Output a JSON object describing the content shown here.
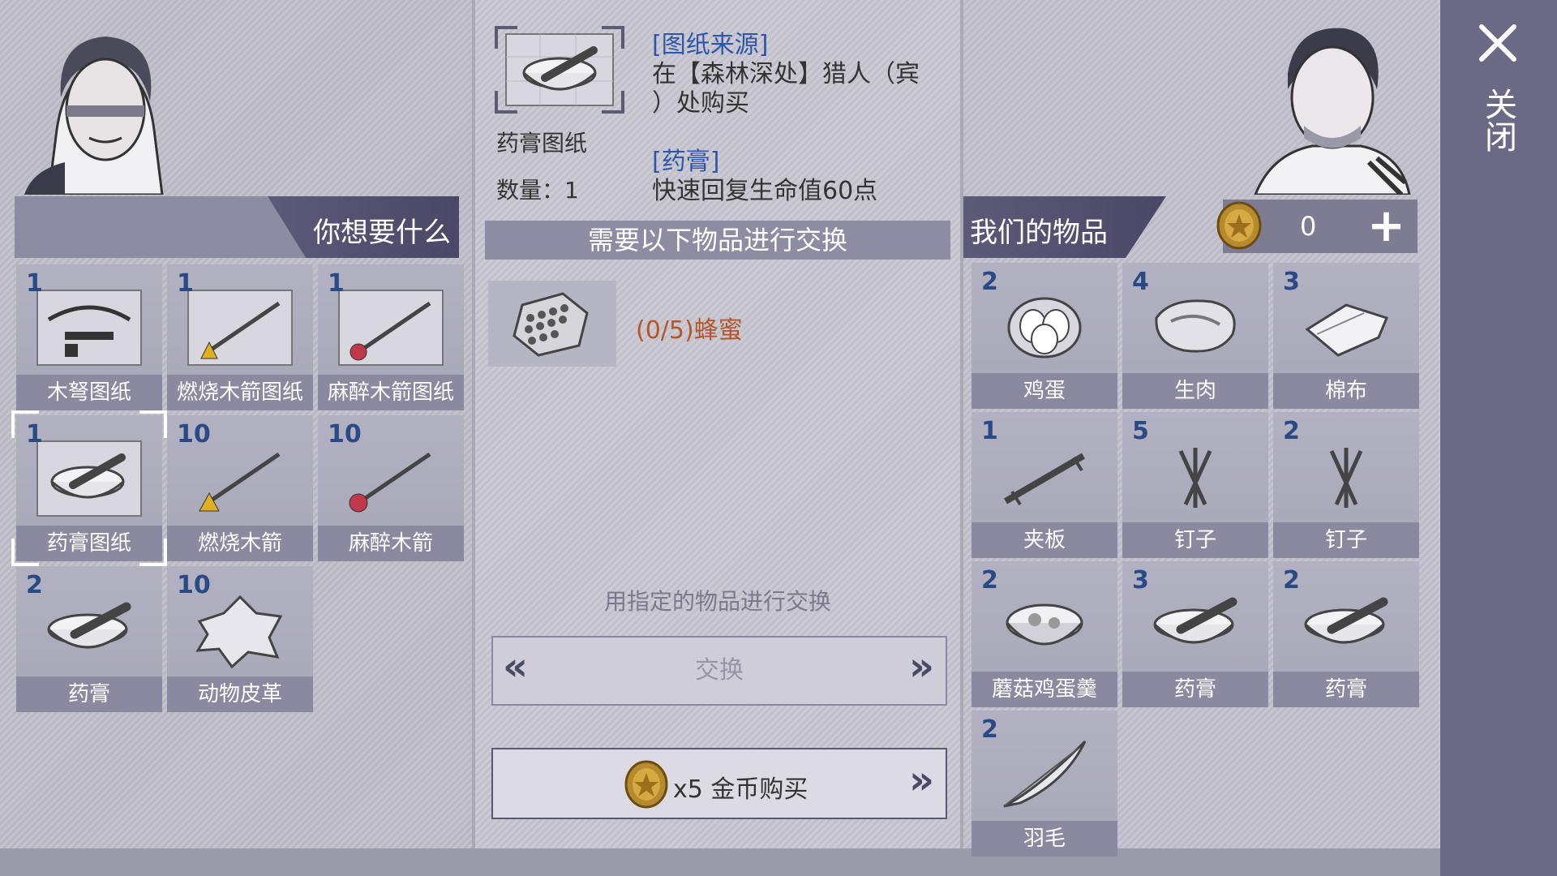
{
  "left": {
    "header": "你想要什么",
    "items": [
      {
        "qty": "1",
        "label": "木弩图纸",
        "icon": "crossbow-blueprint-icon"
      },
      {
        "qty": "1",
        "label": "燃烧木箭图纸",
        "icon": "fire-arrow-blueprint-icon"
      },
      {
        "qty": "1",
        "label": "麻醉木箭图纸",
        "icon": "tranq-arrow-blueprint-icon"
      },
      {
        "qty": "1",
        "label": "药膏图纸",
        "icon": "ointment-blueprint-icon"
      },
      {
        "qty": "10",
        "label": "燃烧木箭",
        "icon": "fire-arrow-icon"
      },
      {
        "qty": "10",
        "label": "麻醉木箭",
        "icon": "tranq-arrow-icon"
      },
      {
        "qty": "2",
        "label": "药膏",
        "icon": "ointment-bowl-icon"
      },
      {
        "qty": "10",
        "label": "动物皮革",
        "icon": "animal-hide-icon"
      }
    ]
  },
  "middle": {
    "item_name": "药膏图纸",
    "quantity": "数量：1",
    "source_title": "[图纸来源]",
    "source_line1": "在【森林深处】猎人（宾",
    "source_line2": "）处购买",
    "effect_title": "[药膏]",
    "effect_desc": "快速回复生命值60点",
    "exchange_header": "需要以下物品进行交换",
    "requirement": "(0/5)蜂蜜",
    "hint": "用指定的物品进行交换",
    "exchange_button": "交换",
    "buy_button": "x5 金币购买"
  },
  "right": {
    "header": "我们的物品",
    "coins": "0",
    "items": [
      {
        "qty": "2",
        "label": "鸡蛋",
        "icon": "eggs-icon"
      },
      {
        "qty": "4",
        "label": "生肉",
        "icon": "raw-meat-icon"
      },
      {
        "qty": "3",
        "label": "棉布",
        "icon": "cotton-cloth-icon"
      },
      {
        "qty": "1",
        "label": "夹板",
        "icon": "splint-icon"
      },
      {
        "qty": "5",
        "label": "钉子",
        "icon": "nails-icon"
      },
      {
        "qty": "2",
        "label": "钉子",
        "icon": "nails-icon"
      },
      {
        "qty": "2",
        "label": "蘑菇鸡蛋羹",
        "icon": "mushroom-egg-soup-icon"
      },
      {
        "qty": "3",
        "label": "药膏",
        "icon": "ointment-bowl-icon"
      },
      {
        "qty": "2",
        "label": "药膏",
        "icon": "ointment-bowl-icon"
      },
      {
        "qty": "2",
        "label": "羽毛",
        "icon": "feather-icon"
      }
    ]
  },
  "close": {
    "label": "关闭"
  },
  "colors": {
    "link": "#2f56a8",
    "requirement": "#b4552a",
    "header_dark": "#4a4866",
    "close_bar": "#6a6a86"
  }
}
